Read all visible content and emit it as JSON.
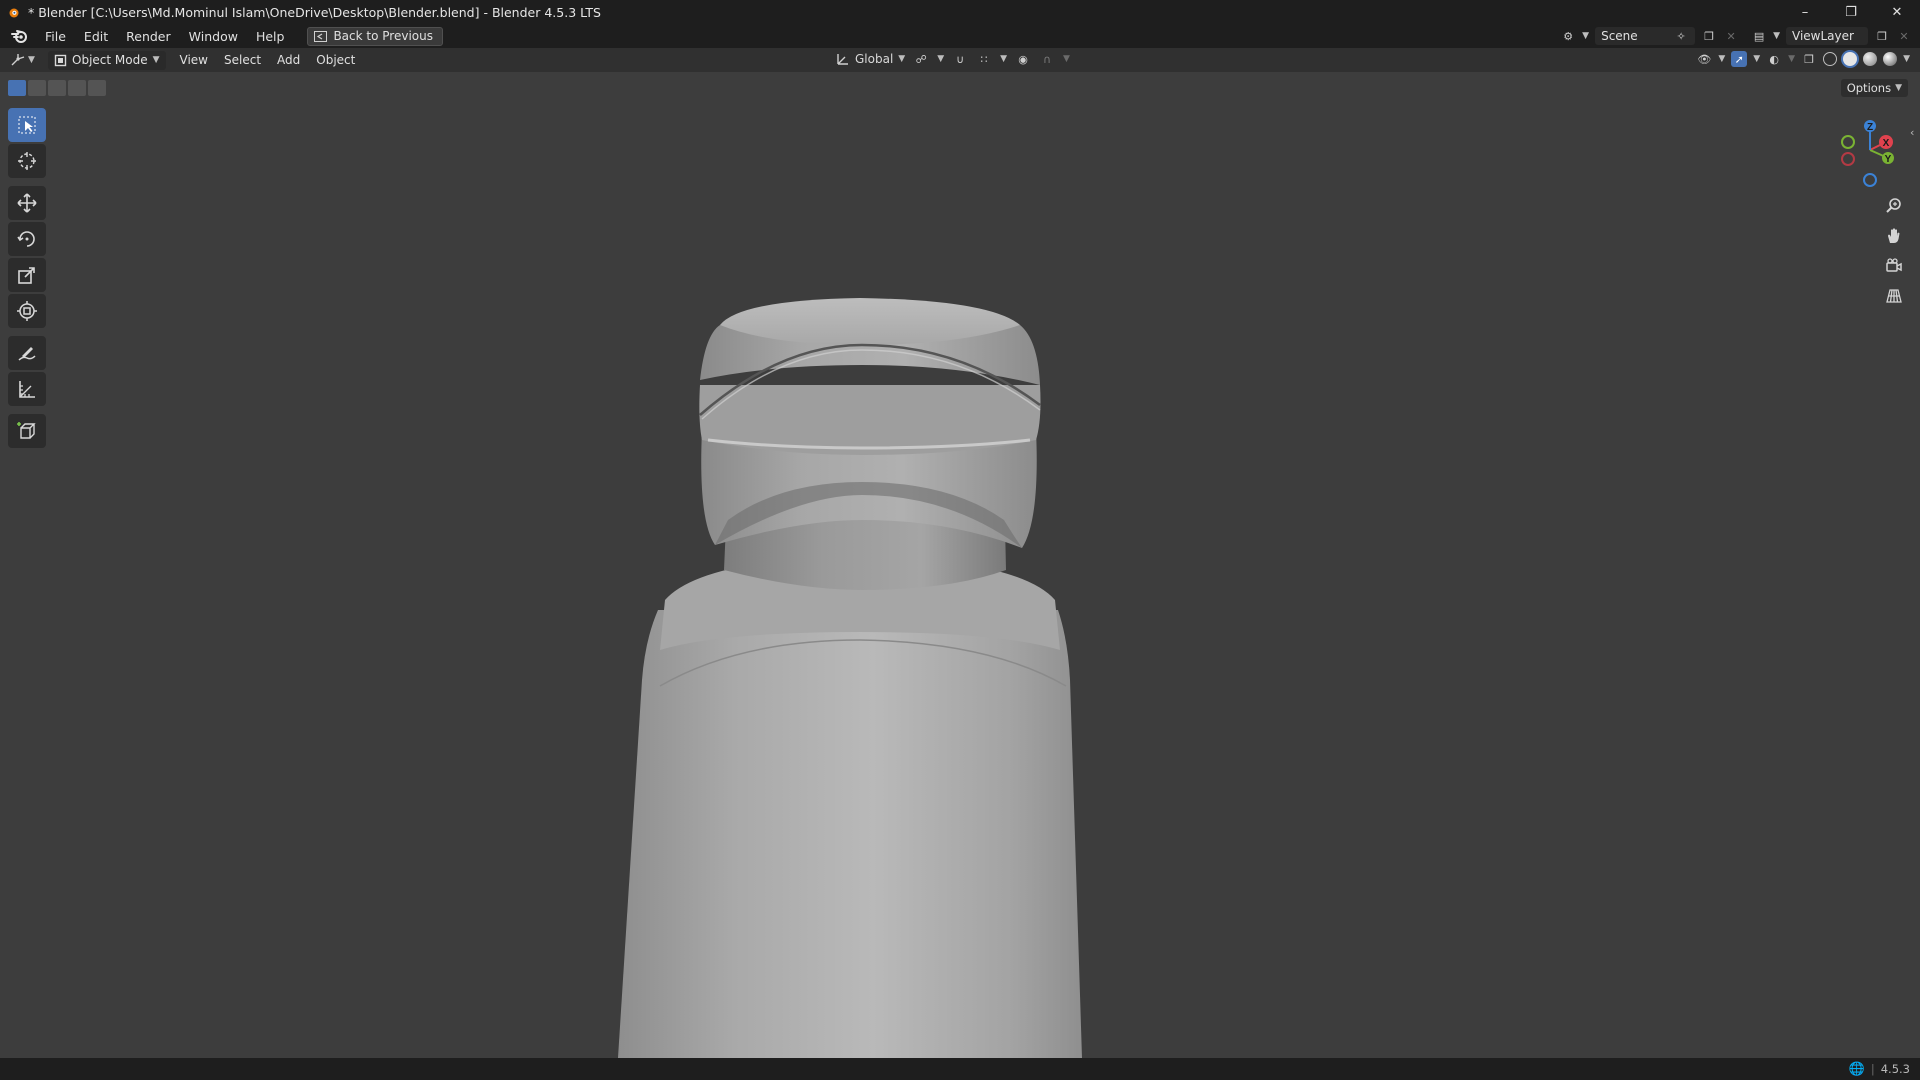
{
  "window": {
    "title": "* Blender [C:\\Users\\Md.Mominul Islam\\OneDrive\\Desktop\\Blender.blend] - Blender 4.5.3 LTS",
    "controls": [
      "minimize-icon",
      "restore-icon",
      "close-icon"
    ]
  },
  "menubar": {
    "items": [
      "File",
      "Edit",
      "Render",
      "Window",
      "Help"
    ],
    "back_button": "Back to Previous",
    "scene": "Scene",
    "view_layer": "ViewLayer"
  },
  "viewport_header": {
    "mode": "Object Mode",
    "menus": [
      "View",
      "Select",
      "Add",
      "Object"
    ],
    "orientation": "Global"
  },
  "options_label": "Options",
  "gizmo": {
    "x_label": "X",
    "y_label": "Y",
    "z_label": "Z",
    "colors": {
      "x": "#e0424e",
      "y": "#7ab333",
      "z": "#3b82d6"
    }
  },
  "toolbar": {
    "tools": [
      "select-box-icon",
      "cursor-icon",
      "move-icon",
      "rotate-icon",
      "scale-icon",
      "transform-icon",
      "annotate-icon",
      "measure-icon",
      "add-cube-icon"
    ],
    "active": "select-box-icon"
  },
  "status": {
    "version": "4.5.3"
  },
  "theme": {
    "accent": "#4772b3",
    "viewport_bg": "#3d3d3d",
    "header_bg": "#303030",
    "bar_bg": "#1e1e1e"
  }
}
